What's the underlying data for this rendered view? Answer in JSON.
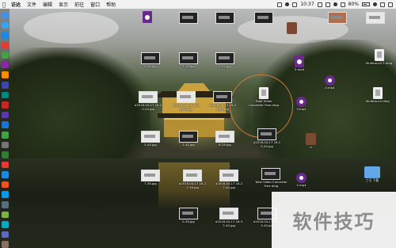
{
  "menubar": {
    "app_name": "访达",
    "items": [
      "文件",
      "编辑",
      "显示",
      "前往",
      "窗口",
      "帮助"
    ],
    "time": "10:37",
    "battery_percent": "80%"
  },
  "dock": {
    "colors": [
      "#4a90e2",
      "#3aa3f0",
      "#1e88e5",
      "#e53935",
      "#43a047",
      "#8e24aa",
      "#fb8c00",
      "#3949ab",
      "#00897b",
      "#c62828",
      "#5e35b1",
      "#1976d2",
      "#43a047",
      "#757575",
      "#2e7d32",
      "#e53935",
      "#1e88e5",
      "#f4511e",
      "#039be5",
      "#546e7a",
      "#7cb342",
      "#00acc1",
      "#5c6bc0",
      "#8d6e63"
    ]
  },
  "icons": [
    {
      "label": ""
    },
    {
      "label": ""
    },
    {
      "label": ""
    },
    {
      "label": "0-08.jpg"
    },
    {
      "label": "7-18.jpg"
    },
    {
      "label": "2-12.jpg"
    },
    {
      "label": "a2018-04-17 16-2\n2-20.jpg"
    },
    {
      "label": "a2018-04-17 16-2\n8-44.jpg"
    },
    {
      "label": "a2018-04-17 16-2\n9-20.jpg"
    },
    {
      "label": "Total Video\nConverter Free.dmg"
    },
    {
      "label": "5-44.jpg"
    },
    {
      "label": "2-44.jpg"
    },
    {
      "label": "6-28.jpg"
    },
    {
      "label": "7-36.jpg"
    },
    {
      "label": "a2018-04-17 16-2\n7-36.jpg"
    },
    {
      "label": "a2018-04-17 16-2\n7-40.jpg"
    },
    {
      "label": "0-28.jpg"
    },
    {
      "label": "a2018-04-17 16-3\n7-40.jpg"
    },
    {
      "label": "a2018-04-17 16-2\n3-40.jpg"
    },
    {
      "label": "5.mp4"
    },
    {
      "label": "4.mp4"
    },
    {
      "label": "3.mp4"
    },
    {
      "label": "2.mp4"
    },
    {
      "label": "Multitouch 2.dmg"
    },
    {
      "label": "Multitouch.dmg"
    },
    {
      "label": "e"
    },
    {
      "label": "a2018-04-17 16-2\n5-44.jpg"
    },
    {
      "label": "Total Video Converter\nFree.dmg"
    },
    {
      "label": "三七 下载"
    }
  ],
  "watermark": "软件技巧"
}
